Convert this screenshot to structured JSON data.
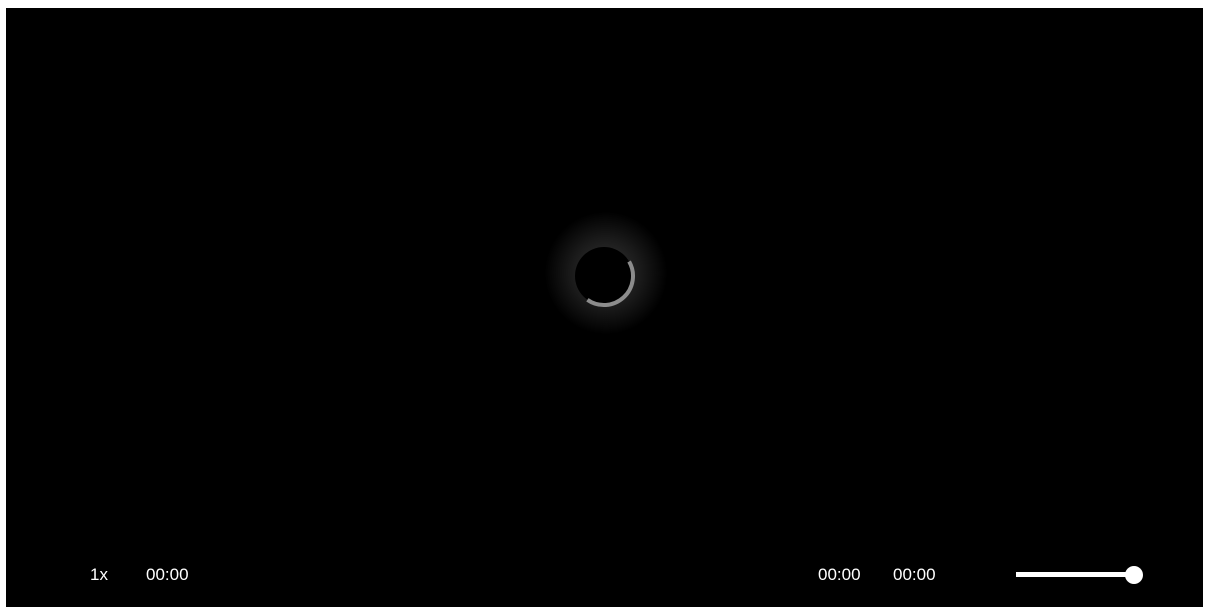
{
  "player": {
    "state": "loading",
    "spinner_icon": "loading-spinner-icon",
    "controls": {
      "speed_label": "1x",
      "current_time": "00:00",
      "time_a": "00:00",
      "time_b": "00:00",
      "volume_level": 1.0
    }
  },
  "colors": {
    "background": "#000000",
    "foreground": "#ffffff",
    "spinner_arc": "#8c8c8c"
  }
}
